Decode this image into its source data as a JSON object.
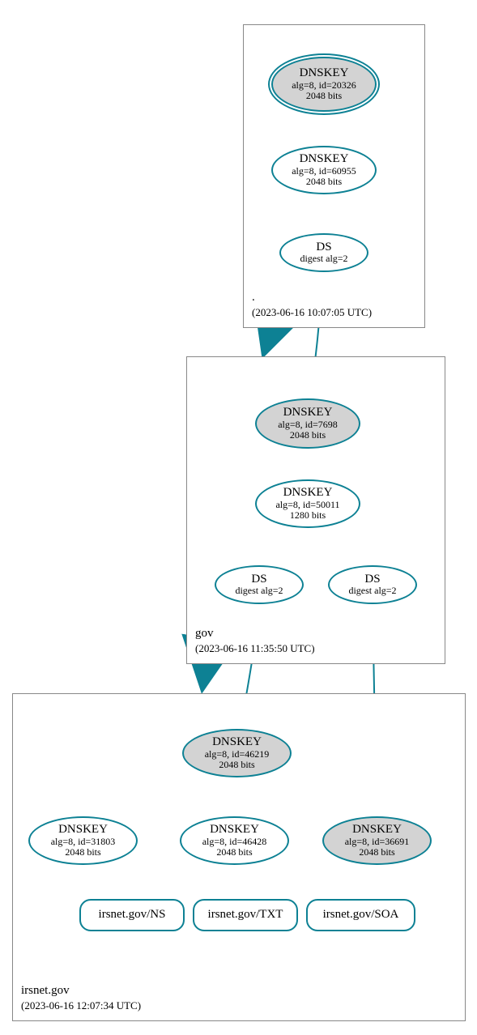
{
  "zones": {
    "root": {
      "name": ".",
      "date": "(2023-06-16 10:07:05 UTC)"
    },
    "gov": {
      "name": "gov",
      "date": "(2023-06-16 11:35:50 UTC)"
    },
    "irsnet": {
      "name": "irsnet.gov",
      "date": "(2023-06-16 12:07:34 UTC)"
    }
  },
  "nodes": {
    "root_ksk": {
      "title": "DNSKEY",
      "line1": "alg=8, id=20326",
      "line2": "2048 bits"
    },
    "root_zsk": {
      "title": "DNSKEY",
      "line1": "alg=8, id=60955",
      "line2": "2048 bits"
    },
    "root_ds": {
      "title": "DS",
      "line1": "digest alg=2"
    },
    "gov_ksk": {
      "title": "DNSKEY",
      "line1": "alg=8, id=7698",
      "line2": "2048 bits"
    },
    "gov_zsk": {
      "title": "DNSKEY",
      "line1": "alg=8, id=50011",
      "line2": "1280 bits"
    },
    "gov_ds1": {
      "title": "DS",
      "line1": "digest alg=2"
    },
    "gov_ds2": {
      "title": "DS",
      "line1": "digest alg=2"
    },
    "irs_ksk": {
      "title": "DNSKEY",
      "line1": "alg=8, id=46219",
      "line2": "2048 bits"
    },
    "irs_key1": {
      "title": "DNSKEY",
      "line1": "alg=8, id=31803",
      "line2": "2048 bits"
    },
    "irs_key2": {
      "title": "DNSKEY",
      "line1": "alg=8, id=46428",
      "line2": "2048 bits"
    },
    "irs_key3": {
      "title": "DNSKEY",
      "line1": "alg=8, id=36691",
      "line2": "2048 bits"
    },
    "irs_ns": {
      "title": "irsnet.gov/NS"
    },
    "irs_txt": {
      "title": "irsnet.gov/TXT"
    },
    "irs_soa": {
      "title": "irsnet.gov/SOA"
    }
  }
}
